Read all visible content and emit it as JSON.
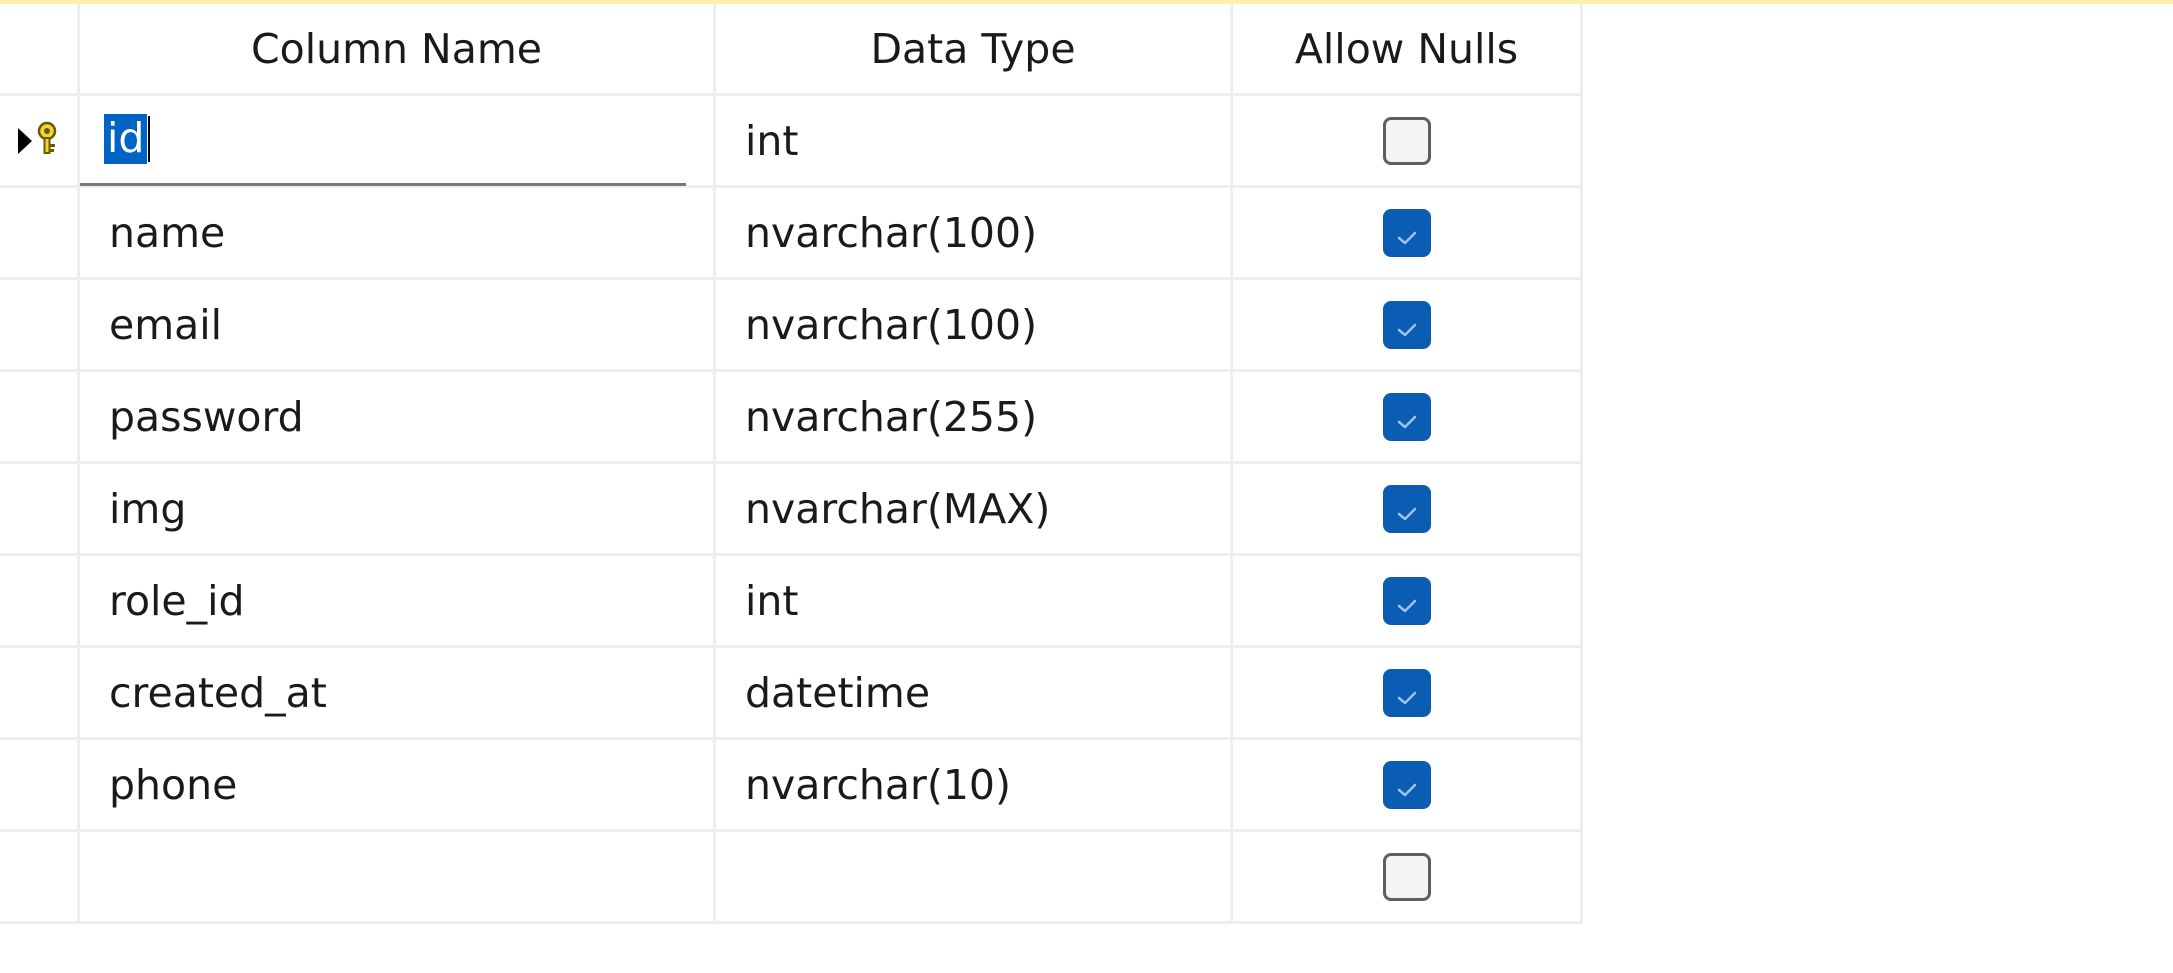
{
  "colors": {
    "accent": "#0b5cb3",
    "selection": "#0063c6",
    "grid_line": "#eeeeee",
    "top_strip": "#fdf0a8"
  },
  "grid": {
    "headers": {
      "column_name": "Column Name",
      "data_type": "Data Type",
      "allow_nulls": "Allow Nulls"
    },
    "current_row_indicator_icon": "primary-key-icon",
    "rows": [
      {
        "name": "id",
        "type": "int",
        "nullable": false,
        "primary_key": true,
        "editing": true
      },
      {
        "name": "name",
        "type": "nvarchar(100)",
        "nullable": true
      },
      {
        "name": "email",
        "type": "nvarchar(100)",
        "nullable": true
      },
      {
        "name": "password",
        "type": "nvarchar(255)",
        "nullable": true
      },
      {
        "name": "img",
        "type": "nvarchar(MAX)",
        "nullable": true
      },
      {
        "name": "role_id",
        "type": "int",
        "nullable": true
      },
      {
        "name": "created_at",
        "type": "datetime",
        "nullable": true
      },
      {
        "name": "phone",
        "type": "nvarchar(10)",
        "nullable": true
      },
      {
        "name": "",
        "type": "",
        "nullable": false
      }
    ]
  }
}
